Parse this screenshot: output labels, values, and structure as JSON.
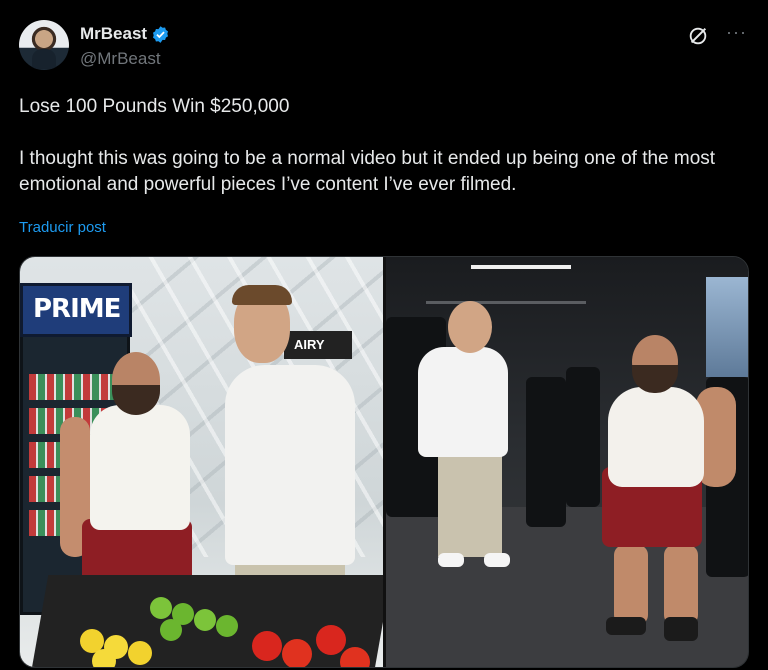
{
  "author": {
    "display_name": "MrBeast",
    "handle": "@MrBeast",
    "verified": true,
    "verified_color": "#1d9bf0"
  },
  "actions": {
    "grok_icon": "grok-icon",
    "more_label": "···"
  },
  "tweet": {
    "title": "Lose 100 Pounds Win $250,000",
    "body": "I thought this was going to be a normal video but it ended up being one of the most emotional and powerful pieces I’ve content I’ve ever filmed.",
    "translate_label": "Traducir post"
  },
  "media": {
    "left_photo": {
      "fridge_brand": "PRIME",
      "store_sign": "AIRY"
    }
  },
  "colors": {
    "background": "#000000",
    "text_primary": "#e7e9ea",
    "text_secondary": "#71767b",
    "link": "#1d9bf0"
  }
}
